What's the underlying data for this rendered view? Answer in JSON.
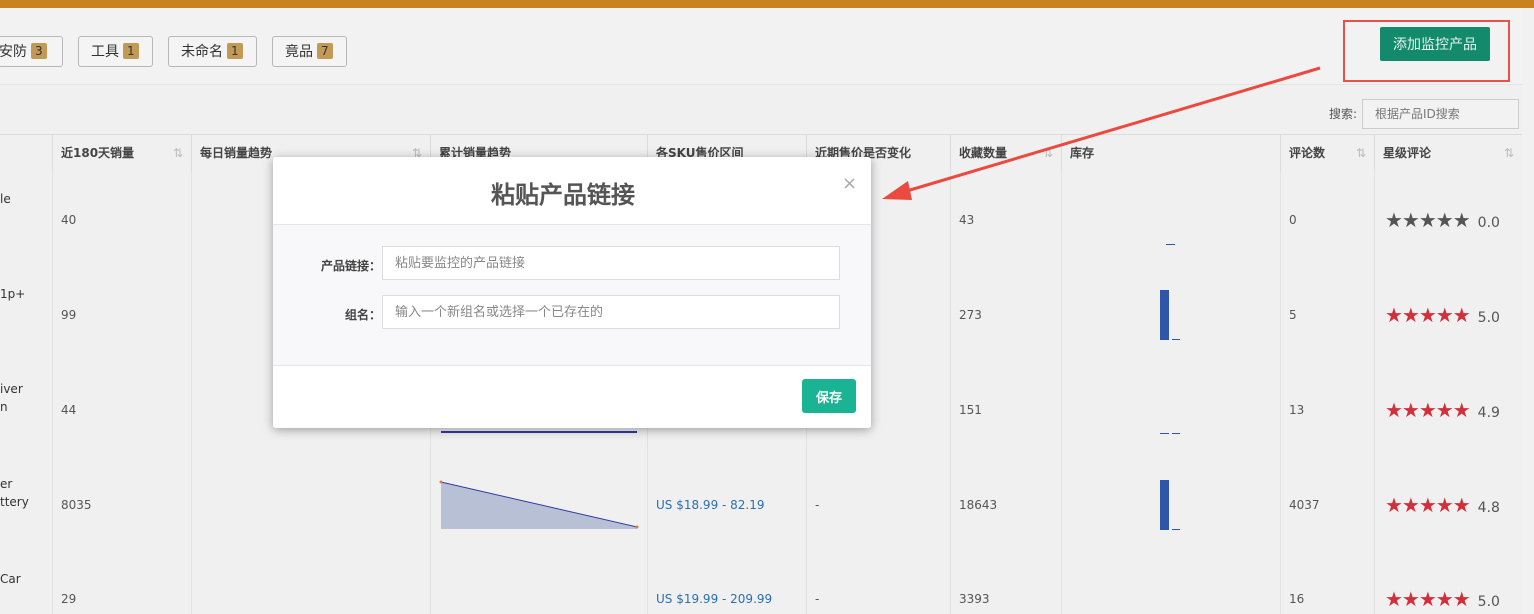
{
  "groups": [
    {
      "name": "安防",
      "count": "3"
    },
    {
      "name": "工具",
      "count": "1"
    },
    {
      "name": "未命名",
      "count": "1"
    },
    {
      "name": "竟品",
      "count": "7"
    }
  ],
  "toolbar": {
    "add_label": "添加监控产品"
  },
  "search": {
    "label": "搜索:",
    "placeholder": "根据产品ID搜索"
  },
  "table": {
    "headers": [
      "近180天销量",
      "每日销量趋势",
      "累计销量趋势",
      "各SKU售价区间",
      "近期售价是否变化",
      "收藏数量",
      "库存",
      "评论数",
      "星级评论"
    ],
    "rows": [
      {
        "name": "le",
        "sales180": "40",
        "price_range": "",
        "price_changed": "",
        "favorites": "43",
        "reviews": "0",
        "stars": "★★★★★",
        "rating": "0.0"
      },
      {
        "name": "1p+",
        "sales180": "99",
        "price_range": "",
        "price_changed": "",
        "favorites": "273",
        "reviews": "5",
        "stars": "★★★★★",
        "rating": "5.0"
      },
      {
        "name": "iver\nn",
        "sales180": "44",
        "price_range": "",
        "price_changed": "",
        "favorites": "151",
        "reviews": "13",
        "stars": "★★★★★",
        "rating": "4.9"
      },
      {
        "name": "er\nttery",
        "sales180": "8035",
        "price_range": "US $18.99 - 82.19",
        "price_changed": "-",
        "favorites": "18643",
        "reviews": "4037",
        "stars": "★★★★★",
        "rating": "4.8"
      },
      {
        "name": "Car",
        "sales180": "29",
        "price_range": "US $19.99 - 209.99",
        "price_changed": "-",
        "favorites": "3393",
        "reviews": "16",
        "stars": "★★★★★",
        "rating": "5.0"
      }
    ]
  },
  "modal": {
    "title": "粘贴产品链接",
    "close": "×",
    "link_label": "产品链接：",
    "link_placeholder": "粘贴要监控的产品链接",
    "group_label": "组名：",
    "group_placeholder": "输入一个新组名或选择一个已存在的",
    "save_label": "保存"
  },
  "colors": {
    "accent": "#1ab394",
    "brand_top": "#c8821f",
    "highlight": "#e8504a",
    "star": "#d32f3a"
  }
}
